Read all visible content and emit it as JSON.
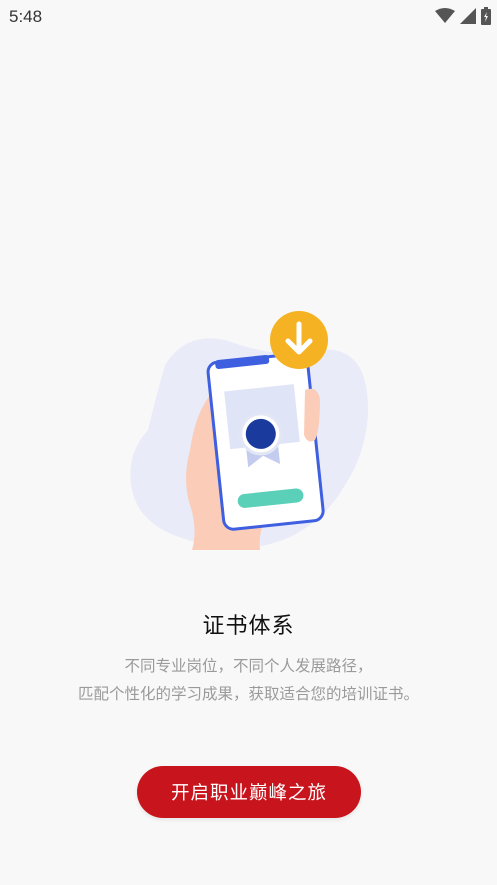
{
  "status_bar": {
    "time": "5:48",
    "icons": [
      "wifi-icon",
      "signal-icon",
      "battery-icon"
    ]
  },
  "illustration": {
    "icons": [
      "download-icon",
      "certificate-badge-icon"
    ]
  },
  "onboarding": {
    "title": "证书体系",
    "description_line1": "不同专业岗位，不同个人发展路径，",
    "description_line2": "匹配个性化的学习成果，获取适合您的培训证书。",
    "cta_label": "开启职业巅峰之旅"
  },
  "colors": {
    "background": "#f8f8f8",
    "accent": "#c8151d",
    "phone_outline": "#3d5fe0",
    "download_badge": "#f5b324",
    "progress_bar": "#5ad0b8"
  }
}
